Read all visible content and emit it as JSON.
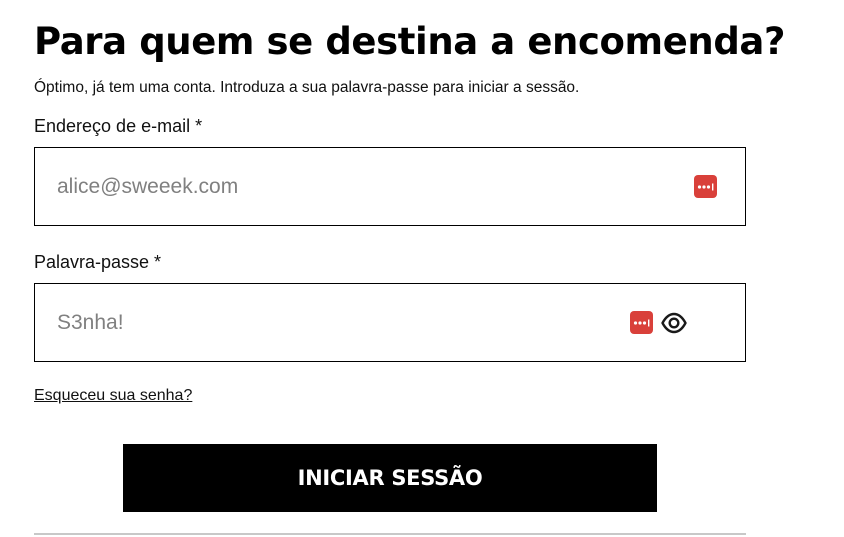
{
  "header": {
    "title": "Para quem se destina a encomenda?",
    "subtitle": "Óptimo, já tem uma conta. Introduza a sua palavra-passe para iniciar a sessão."
  },
  "form": {
    "email": {
      "label": "Endereço de e-mail *",
      "placeholder": "alice@sweeek.com",
      "icon": "password-manager-icon"
    },
    "password": {
      "label": "Palavra-passe *",
      "placeholder": "S3nha!",
      "icons": [
        "password-manager-icon",
        "eye-icon"
      ]
    },
    "forgot_link": "Esqueceu sua senha?",
    "submit_label": "INICIAR SESSÃO"
  },
  "colors": {
    "accent": "#d9403a",
    "button_bg": "#000000",
    "button_text": "#ffffff",
    "divider": "#c8c8c8"
  }
}
